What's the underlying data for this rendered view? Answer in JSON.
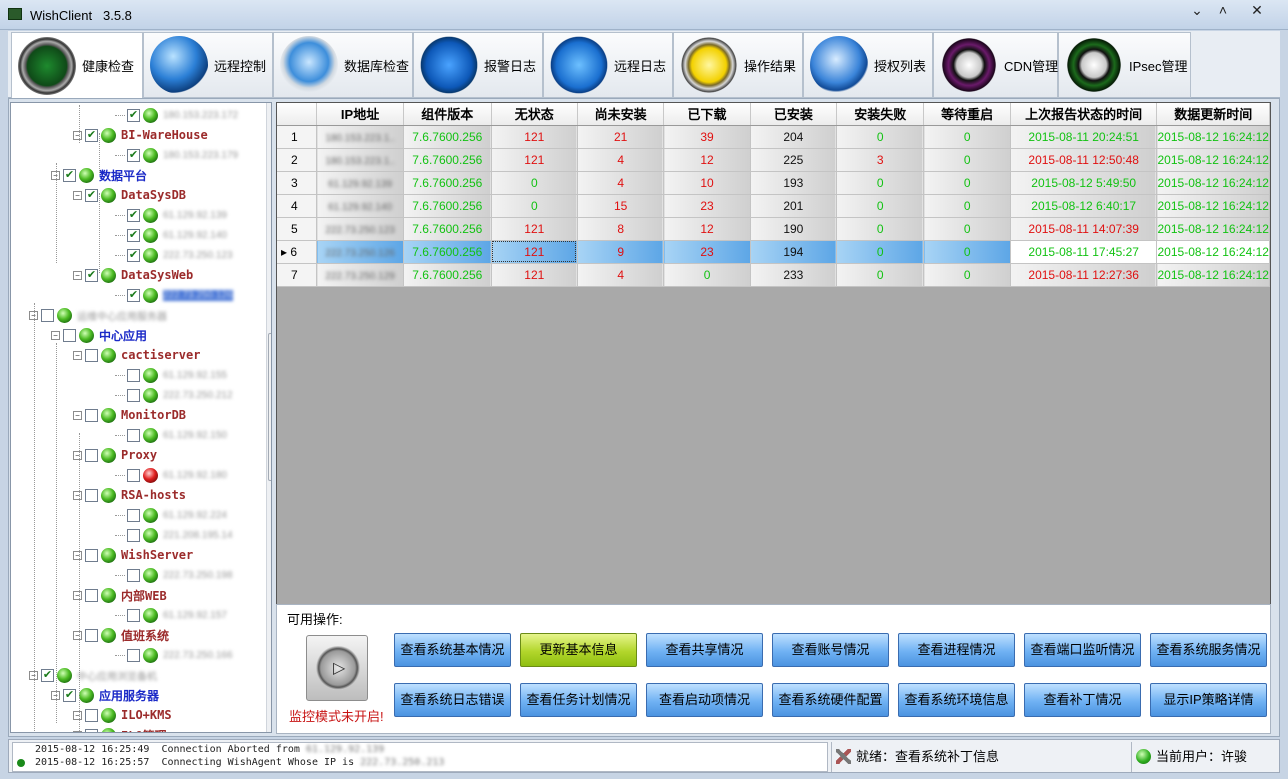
{
  "window": {
    "title": "WishClient",
    "version": "3.5.8"
  },
  "tabs": [
    {
      "label": "健康检查",
      "icon": "radar-icon",
      "active": true
    },
    {
      "label": "远程控制",
      "icon": "globe-icon"
    },
    {
      "label": "数据库检查",
      "icon": "database-icon"
    },
    {
      "label": "报警日志",
      "icon": "megaphone-icon"
    },
    {
      "label": "远程日志",
      "icon": "wrench-globe-icon"
    },
    {
      "label": "操作结果",
      "icon": "x-badge-icon"
    },
    {
      "label": "授权列表",
      "icon": "cube-icon"
    },
    {
      "label": "CDN管理",
      "icon": "yin-yang-purple-icon"
    },
    {
      "label": "IPsec管理",
      "icon": "yin-yang-green-icon"
    }
  ],
  "tree": [
    {
      "label": "180.153.223.172",
      "kind": "ip",
      "checked": true
    },
    {
      "label": "BI-WareHouse",
      "kind": "host",
      "checked": true
    },
    {
      "label": "180.153.223.179",
      "kind": "ip",
      "checked": true
    },
    {
      "label": "数据平台",
      "kind": "group",
      "checked": true
    },
    {
      "label": "DataSysDB",
      "kind": "host",
      "checked": true
    },
    {
      "label": "61.129.92.139",
      "kind": "ip",
      "checked": true
    },
    {
      "label": "61.129.92.140",
      "kind": "ip",
      "checked": true
    },
    {
      "label": "222.73.250.123",
      "kind": "ip",
      "checked": true
    },
    {
      "label": "DataSysWeb",
      "kind": "host",
      "checked": true
    },
    {
      "label": "222.73.250.126",
      "kind": "ip-selected",
      "checked": true
    },
    {
      "label": "运维中心应用服务器",
      "kind": "group-blur",
      "checked": false
    },
    {
      "label": "中心应用",
      "kind": "group",
      "checked": false
    },
    {
      "label": "cactiserver",
      "kind": "host",
      "checked": false
    },
    {
      "label": "61.129.92.155",
      "kind": "ip",
      "checked": false
    },
    {
      "label": "222.73.250.212",
      "kind": "ip",
      "checked": false
    },
    {
      "label": "MonitorDB",
      "kind": "host",
      "checked": false
    },
    {
      "label": "61.129.92.150",
      "kind": "ip",
      "checked": false
    },
    {
      "label": "Proxy",
      "kind": "host",
      "checked": false
    },
    {
      "label": "61.129.92.180",
      "kind": "ip-red",
      "checked": false
    },
    {
      "label": "RSA-hosts",
      "kind": "host",
      "checked": false
    },
    {
      "label": "61.129.92.224",
      "kind": "ip",
      "checked": false
    },
    {
      "label": "221.208.195.14",
      "kind": "ip",
      "checked": false
    },
    {
      "label": "WishServer",
      "kind": "host",
      "checked": false
    },
    {
      "label": "222.73.250.198",
      "kind": "ip",
      "checked": false
    },
    {
      "label": "内部WEB",
      "kind": "host",
      "checked": false
    },
    {
      "label": "61.129.92.157",
      "kind": "ip",
      "checked": false
    },
    {
      "label": "值班系统",
      "kind": "host",
      "checked": false
    },
    {
      "label": "222.73.250.166",
      "kind": "ip",
      "checked": false
    },
    {
      "label": "中心应用浏览备机",
      "kind": "group-blur",
      "checked": true
    },
    {
      "label": "应用服务器",
      "kind": "group",
      "checked": true
    },
    {
      "label": "ILO+KMS",
      "kind": "host",
      "checked": false
    },
    {
      "label": "ILO管理",
      "kind": "host",
      "checked": false
    }
  ],
  "grid": {
    "columns": [
      "",
      "IP地址",
      "组件版本",
      "无状态",
      "尚未安装",
      "已下载",
      "已安装",
      "安装失败",
      "等待重启",
      "上次报告状态的时间",
      "数据更新时间"
    ],
    "rows": [
      {
        "n": "1",
        "ip": "180.153.223.1..",
        "ver": "7.6.7600.256",
        "nostate": "121",
        "notinst": "21",
        "downloaded": "39",
        "installed": "204",
        "failed": "0",
        "reboot": "0",
        "lastreport": "2015-08-11 20:24:51",
        "updated": "2015-08-12 16:24:12",
        "lastColor": "green",
        "nostateColor": "red"
      },
      {
        "n": "2",
        "ip": "180.153.223.1..",
        "ver": "7.6.7600.256",
        "nostate": "121",
        "notinst": "4",
        "downloaded": "12",
        "installed": "225",
        "failed": "3",
        "reboot": "0",
        "lastreport": "2015-08-11 12:50:48",
        "updated": "2015-08-12 16:24:12",
        "lastColor": "red",
        "nostateColor": "red"
      },
      {
        "n": "3",
        "ip": "61.129.92.139",
        "ver": "7.6.7600.256",
        "nostate": "0",
        "notinst": "4",
        "downloaded": "10",
        "installed": "193",
        "failed": "0",
        "reboot": "0",
        "lastreport": "2015-08-12 5:49:50",
        "updated": "2015-08-12 16:24:12",
        "lastColor": "green",
        "nostateColor": "green"
      },
      {
        "n": "4",
        "ip": "61.129.92.140",
        "ver": "7.6.7600.256",
        "nostate": "0",
        "notinst": "15",
        "downloaded": "23",
        "installed": "201",
        "failed": "0",
        "reboot": "0",
        "lastreport": "2015-08-12 6:40:17",
        "updated": "2015-08-12 16:24:12",
        "lastColor": "green",
        "nostateColor": "green"
      },
      {
        "n": "5",
        "ip": "222.73.250.123",
        "ver": "7.6.7600.256",
        "nostate": "121",
        "notinst": "8",
        "downloaded": "12",
        "installed": "190",
        "failed": "0",
        "reboot": "0",
        "lastreport": "2015-08-11 14:07:39",
        "updated": "2015-08-12 16:24:12",
        "lastColor": "red",
        "nostateColor": "red"
      },
      {
        "n": "6",
        "ip": "222.73.250.126",
        "ver": "7.6.7600.256",
        "nostate": "121",
        "notinst": "9",
        "downloaded": "23",
        "installed": "194",
        "failed": "0",
        "reboot": "0",
        "lastreport": "2015-08-11 17:45:27",
        "updated": "2015-08-12 16:24:12",
        "lastColor": "green",
        "nostateColor": "red",
        "selected": true
      },
      {
        "n": "7",
        "ip": "222.73.250.129",
        "ver": "7.6.7600.256",
        "nostate": "121",
        "notinst": "4",
        "downloaded": "0",
        "installed": "233",
        "failed": "0",
        "reboot": "0",
        "lastreport": "2015-08-11 12:27:36",
        "updated": "2015-08-12 16:24:12",
        "lastColor": "red",
        "nostateColor": "red",
        "dlColor": "green"
      }
    ]
  },
  "actions": {
    "label": "可用操作:",
    "monitor_status": "监控模式未开启!",
    "row1": [
      "查看系统基本情况",
      "更新基本信息",
      "查看共享情况",
      "查看账号情况",
      "查看进程情况",
      "查看端口监听情况",
      "查看系统服务情况"
    ],
    "row2": [
      "查看系统日志错误",
      "查看任务计划情况",
      "查看启动项情况",
      "查看系统硬件配置",
      "查看系统环境信息",
      "查看补丁情况",
      "显示IP策略详情"
    ]
  },
  "status": {
    "log": [
      {
        "time": "2015-08-12 16:25:49",
        "msg": "Connection Aborted from",
        "ip": "61.129.92.139"
      },
      {
        "time": "2015-08-12 16:25:57",
        "msg": "Connecting WishAgent Whose IP is",
        "ip": "222.73.250.213"
      }
    ],
    "ready": "就绪：查看系统补丁信息",
    "user": "当前用户：许骏"
  },
  "colors": {
    "green": "#12c212",
    "red": "#e01010",
    "accent": "#4b93e0",
    "treeHost": "#9b2b2b",
    "treeGroup": "#1b2ac7"
  }
}
